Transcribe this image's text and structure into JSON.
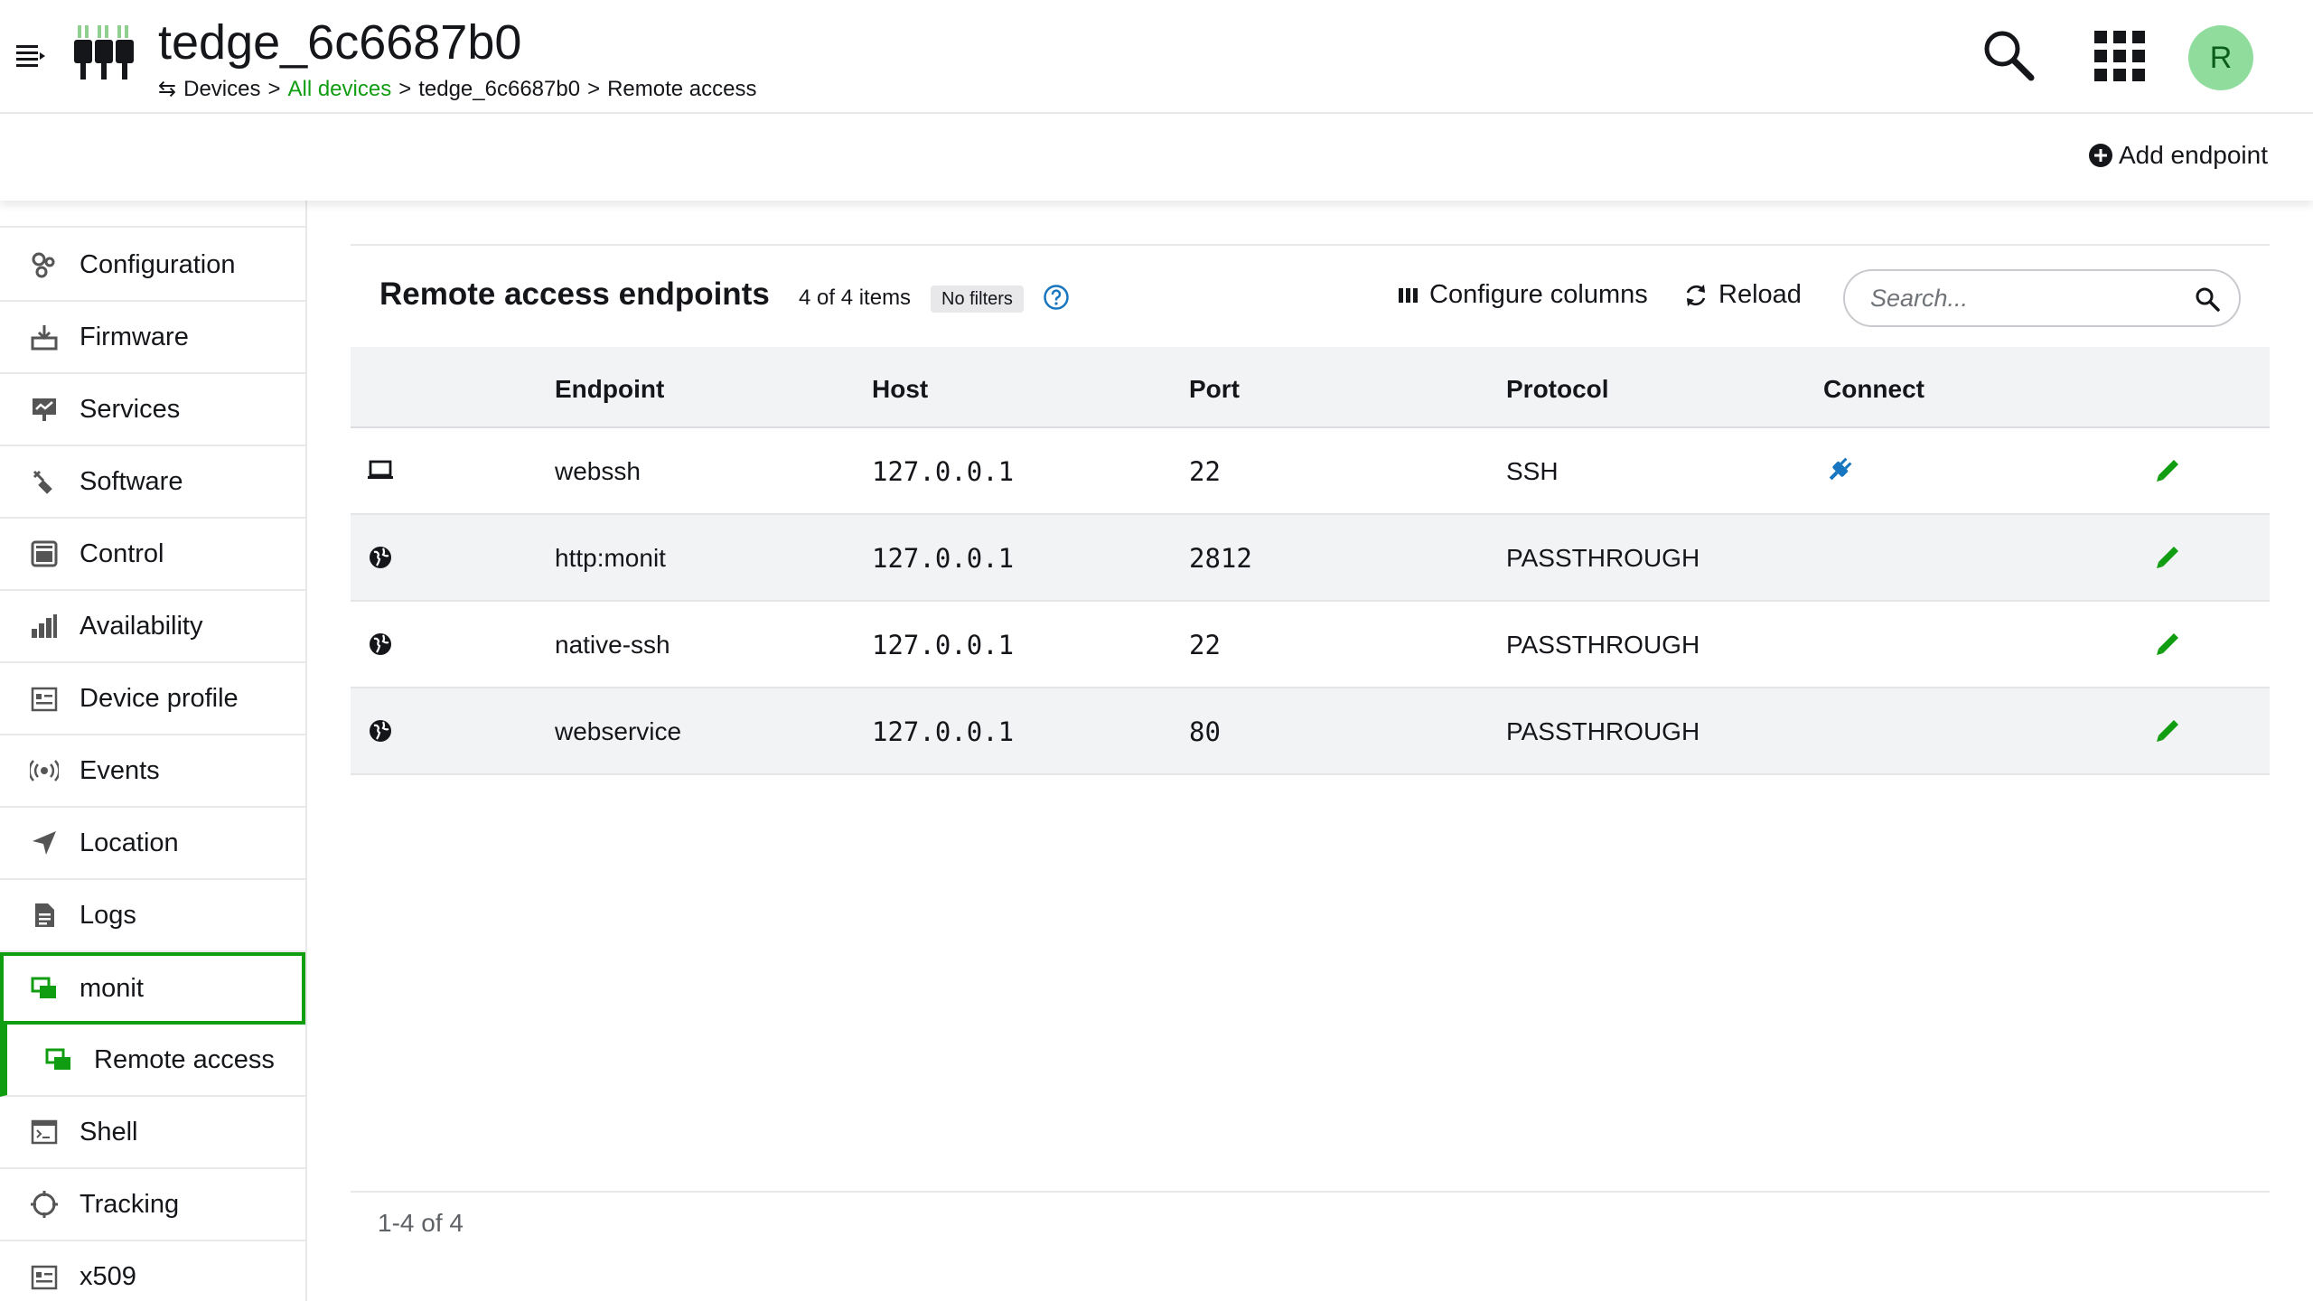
{
  "header": {
    "device_title": "tedge_6c6687b0",
    "breadcrumb": {
      "root": "Devices",
      "separator": ">",
      "link": "All devices",
      "device": "tedge_6c6687b0",
      "current": "Remote access"
    },
    "avatar_initial": "R"
  },
  "action_bar": {
    "add_endpoint_label": "Add endpoint"
  },
  "sidebar": {
    "items": [
      {
        "label": "Configuration",
        "icon": "configuration-icon"
      },
      {
        "label": "Firmware",
        "icon": "firmware-icon"
      },
      {
        "label": "Services",
        "icon": "services-icon"
      },
      {
        "label": "Software",
        "icon": "software-icon"
      },
      {
        "label": "Control",
        "icon": "control-icon"
      },
      {
        "label": "Availability",
        "icon": "availability-icon"
      },
      {
        "label": "Device profile",
        "icon": "device-profile-icon"
      },
      {
        "label": "Events",
        "icon": "events-icon"
      },
      {
        "label": "Location",
        "icon": "location-icon"
      },
      {
        "label": "Logs",
        "icon": "logs-icon"
      },
      {
        "label": "monit",
        "icon": "monit-icon",
        "state": "active-parent"
      },
      {
        "label": "Remote access",
        "icon": "remote-access-icon",
        "state": "active-child"
      },
      {
        "label": "Shell",
        "icon": "shell-icon"
      },
      {
        "label": "Tracking",
        "icon": "tracking-icon"
      },
      {
        "label": "x509",
        "icon": "x509-icon"
      }
    ]
  },
  "card": {
    "title": "Remote access endpoints",
    "item_count": "4 of 4 items",
    "filter_badge": "No filters",
    "configure_columns_label": "Configure columns",
    "reload_label": "Reload",
    "search_placeholder": "Search..."
  },
  "table": {
    "columns": [
      "Endpoint",
      "Host",
      "Port",
      "Protocol",
      "Connect"
    ],
    "rows": [
      {
        "icon": "laptop-icon",
        "endpoint": "webssh",
        "host": "127.0.0.1",
        "port": "22",
        "protocol": "SSH",
        "connect": true
      },
      {
        "icon": "globe-icon",
        "endpoint": "http:monit",
        "host": "127.0.0.1",
        "port": "2812",
        "protocol": "PASSTHROUGH",
        "connect": false
      },
      {
        "icon": "globe-icon",
        "endpoint": "native-ssh",
        "host": "127.0.0.1",
        "port": "22",
        "protocol": "PASSTHROUGH",
        "connect": false
      },
      {
        "icon": "globe-icon",
        "endpoint": "webservice",
        "host": "127.0.0.1",
        "port": "80",
        "protocol": "PASSTHROUGH",
        "connect": false
      }
    ]
  },
  "pagination": {
    "label": "1-4 of 4"
  },
  "colors": {
    "accent_green": "#119d11",
    "connect_blue": "#1776bf",
    "avatar_bg": "#8fdc9d",
    "row_alt_bg": "#f2f3f4"
  }
}
